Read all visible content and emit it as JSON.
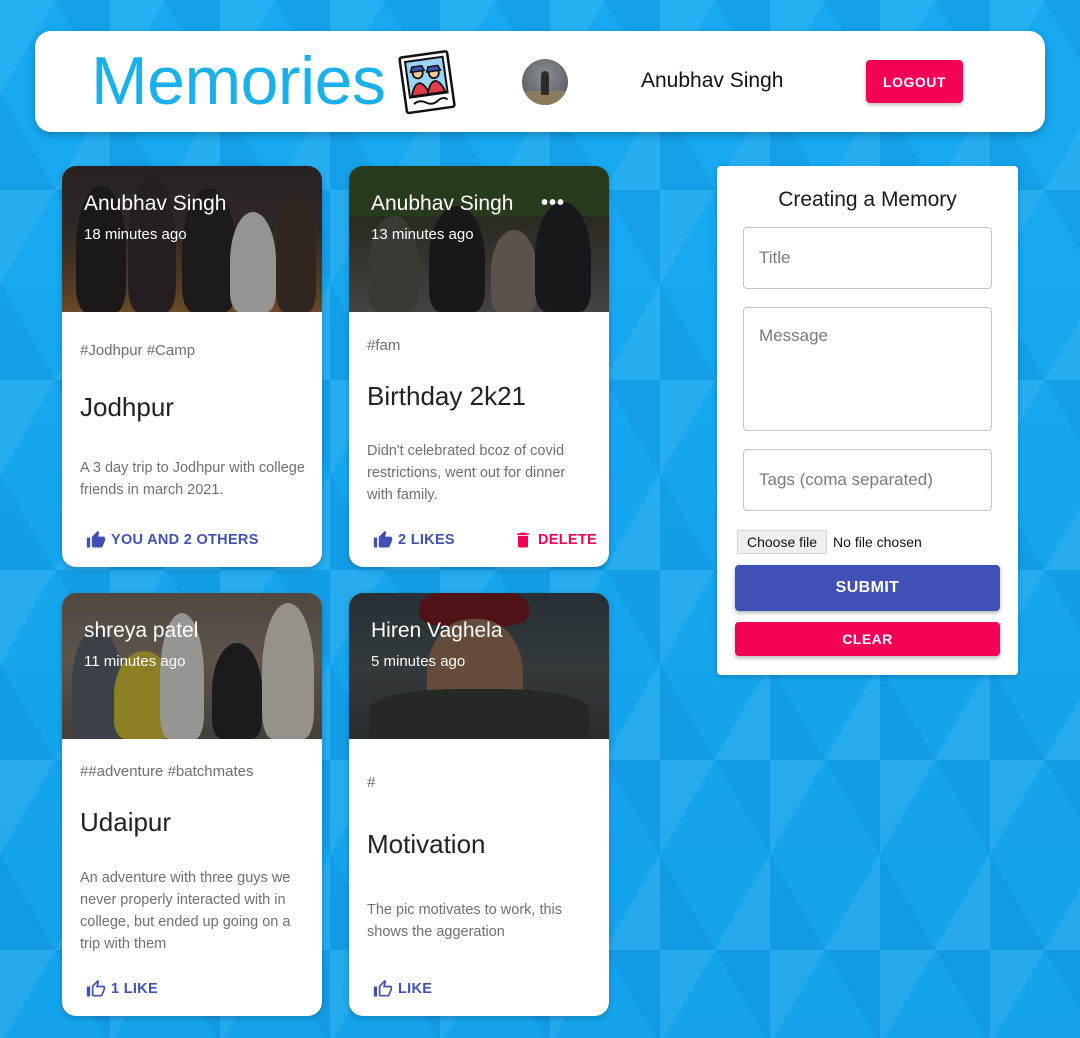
{
  "header": {
    "brand": "Memories",
    "brand_icon": "photo-memories-icon",
    "user_name": "Anubhav Singh",
    "logout_label": "LOGOUT"
  },
  "posts": [
    {
      "author": "Anubhav Singh",
      "time": "18 minutes ago",
      "tags": "#Jodhpur #Camp",
      "title": "Jodhpur",
      "message": "A 3 day trip to Jodhpur with college friends in march 2021.",
      "like_label": "YOU AND 2 OTHERS",
      "like_icon": "thumb-up-filled-icon"
    },
    {
      "author": "Anubhav Singh",
      "time": "13 minutes ago",
      "more": "•••",
      "tags": "#fam",
      "title": "Birthday 2k21",
      "message": "Didn't celebrated bcoz of covid restrictions, went out for dinner with family.",
      "like_label": "2 LIKES",
      "like_icon": "thumb-up-filled-icon",
      "delete_label": "DELETE",
      "delete_icon": "trash-icon"
    },
    {
      "author": "shreya patel",
      "time": "11 minutes ago",
      "tags": "##adventure #batchmates",
      "title": "Udaipur",
      "message": "An adventure with three guys we never properly interacted with in college, but ended up going on a trip with them",
      "like_label": "1 LIKE",
      "like_icon": "thumb-up-outline-icon"
    },
    {
      "author": "Hiren Vaghela",
      "time": "5 minutes ago",
      "tags": "#",
      "title": "Motivation",
      "message": "The pic motivates to work, this shows the aggeration",
      "like_label": "LIKE",
      "like_icon": "thumb-up-outline-icon"
    }
  ],
  "form": {
    "heading": "Creating a Memory",
    "title_placeholder": "Title",
    "message_placeholder": "Message",
    "tags_placeholder": "Tags (coma separated)",
    "file_button": "Choose file",
    "file_status": "No file chosen",
    "submit_label": "SUBMIT",
    "clear_label": "CLEAR"
  },
  "colors": {
    "brand": "#1ab0ec",
    "primary": "#3f51b5",
    "secondary": "#f50057",
    "background": "#17acf3"
  }
}
